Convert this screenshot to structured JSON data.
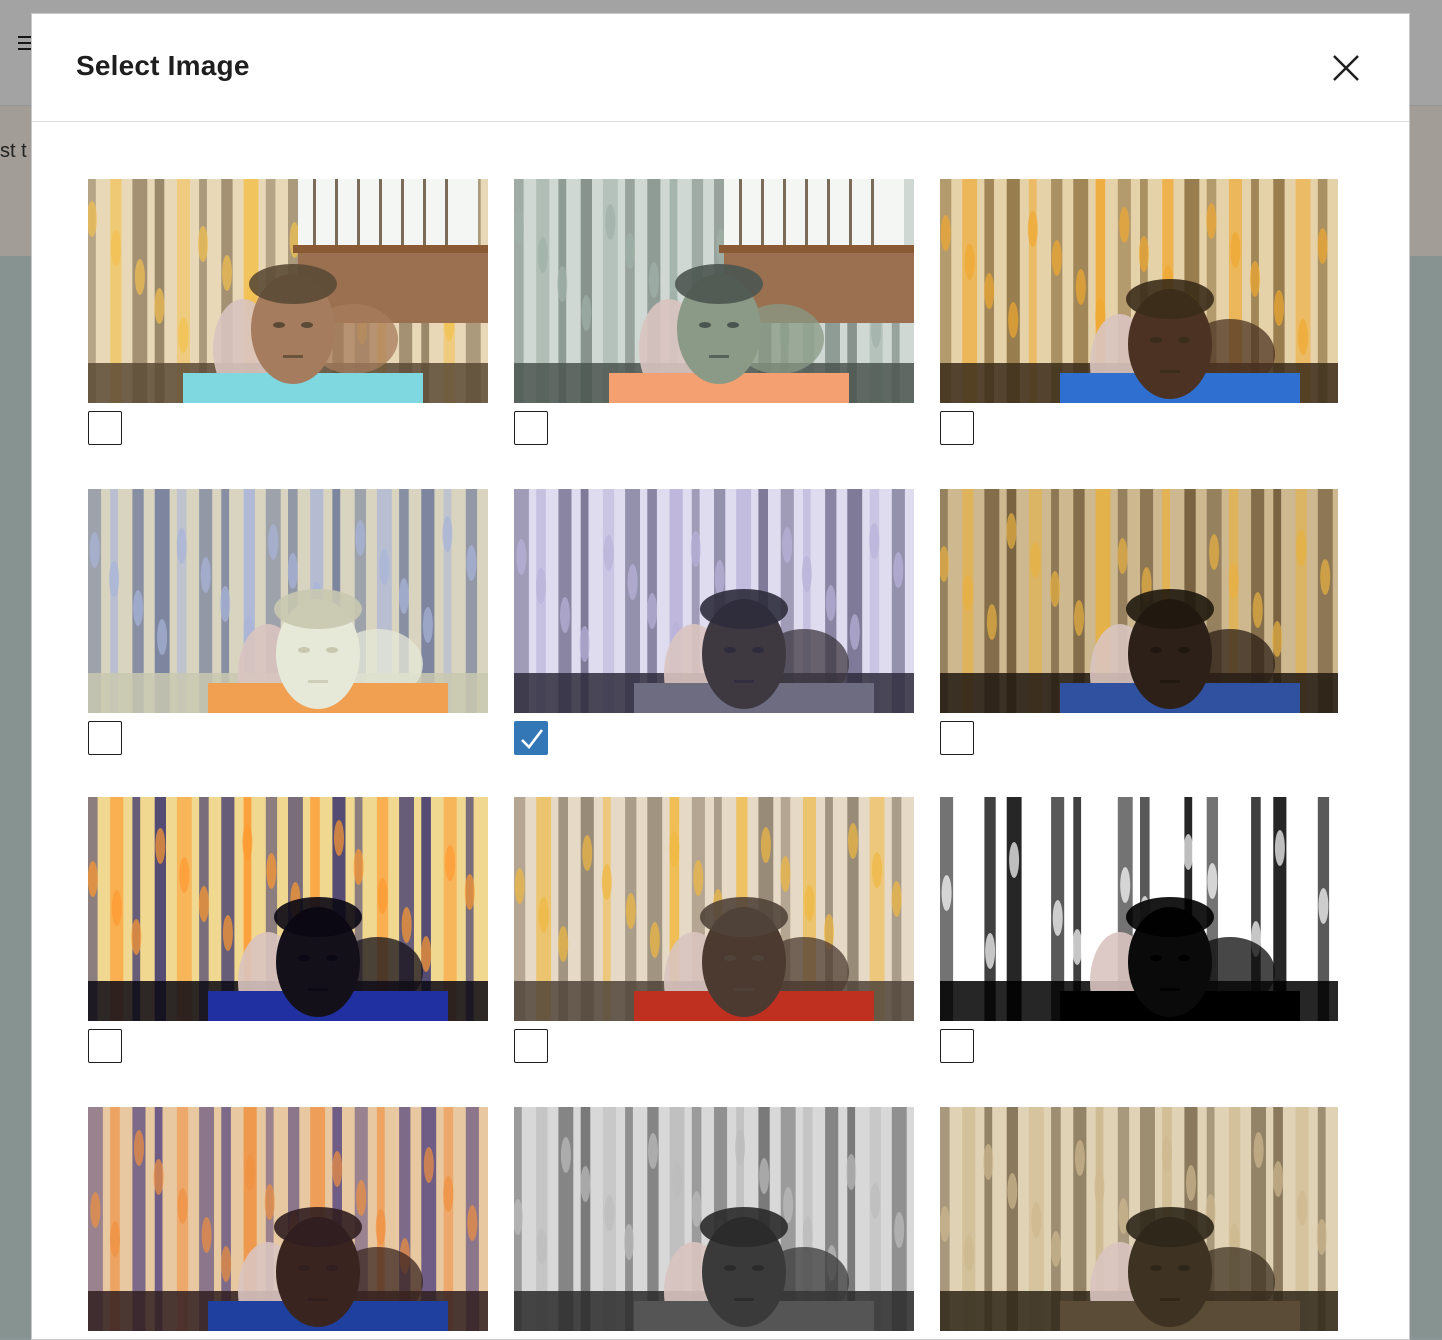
{
  "background": {
    "banner_text": "st t"
  },
  "dialog": {
    "title": "Select Image",
    "close_icon": "close-icon"
  },
  "images": [
    {
      "filter": "original",
      "checked": false,
      "curtain": "window"
    },
    {
      "filter": "cool-tint",
      "checked": false,
      "curtain": "window"
    },
    {
      "filter": "warm",
      "checked": false,
      "curtain": "curtain"
    },
    {
      "filter": "invert",
      "checked": false,
      "curtain": "curtain"
    },
    {
      "filter": "blue-tint",
      "checked": true,
      "curtain": "curtain"
    },
    {
      "filter": "dark",
      "checked": false,
      "curtain": "curtain"
    },
    {
      "filter": "high-contrast",
      "checked": false,
      "curtain": "curtain"
    },
    {
      "filter": "natural",
      "checked": false,
      "curtain": "curtain"
    },
    {
      "filter": "threshold",
      "checked": false,
      "curtain": "curtain"
    },
    {
      "filter": "saturated",
      "checked": false,
      "curtain": "curtain"
    },
    {
      "filter": "grayscale",
      "checked": false,
      "curtain": "curtain"
    },
    {
      "filter": "sepia",
      "checked": false,
      "curtain": "curtain"
    }
  ],
  "colors": {
    "checkbox_checked": "#3477b6",
    "title": "#1e1e1e"
  }
}
